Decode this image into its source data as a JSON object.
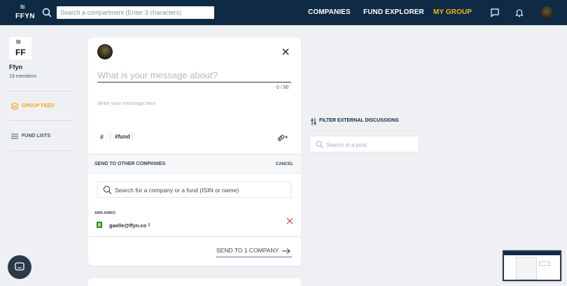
{
  "topbar": {
    "logo_text": "FFYN",
    "search_placeholder": "Search a compartment (Enter 3 characters)",
    "nav": [
      "COMPANIES",
      "FUND EXPLORER",
      "MY GROUP"
    ],
    "active_nav": "MY GROUP",
    "icons": [
      "search-icon",
      "chat-icon",
      "bell-icon",
      "user-avatar"
    ]
  },
  "sidebar": {
    "logo_text": "FF",
    "group_name": "Ffyn",
    "members": "19 members",
    "items": [
      {
        "label": "GROUP FEED",
        "icon": "layers-icon",
        "active": true
      },
      {
        "label": "FUND LISTS",
        "icon": "list-icon",
        "active": false
      }
    ]
  },
  "composer": {
    "subject_placeholder": "What is your message about?",
    "counter": "0 / 90",
    "body_placeholder": "Write your message here",
    "hash_symbol": "#",
    "tag": "#fund",
    "send_section_title": "SEND TO OTHER COMPANIES",
    "cancel_label": "CANCEL",
    "company_search_placeholder": "Search for a company or a fund (ISIN or name)",
    "recipient_company": "ABN AMRO",
    "recipient_email": "gaelle@ffyn.co",
    "send_label": "SEND TO 1 COMPANY"
  },
  "right_panel": {
    "filter_label": "FILTER EXTERNAL DISCUSSIONS",
    "post_search_placeholder": "Search in a post"
  },
  "colors": {
    "navy": "#0f2a44",
    "accent": "#f3b51b",
    "danger": "#e05555",
    "background": "#eef0f3"
  }
}
